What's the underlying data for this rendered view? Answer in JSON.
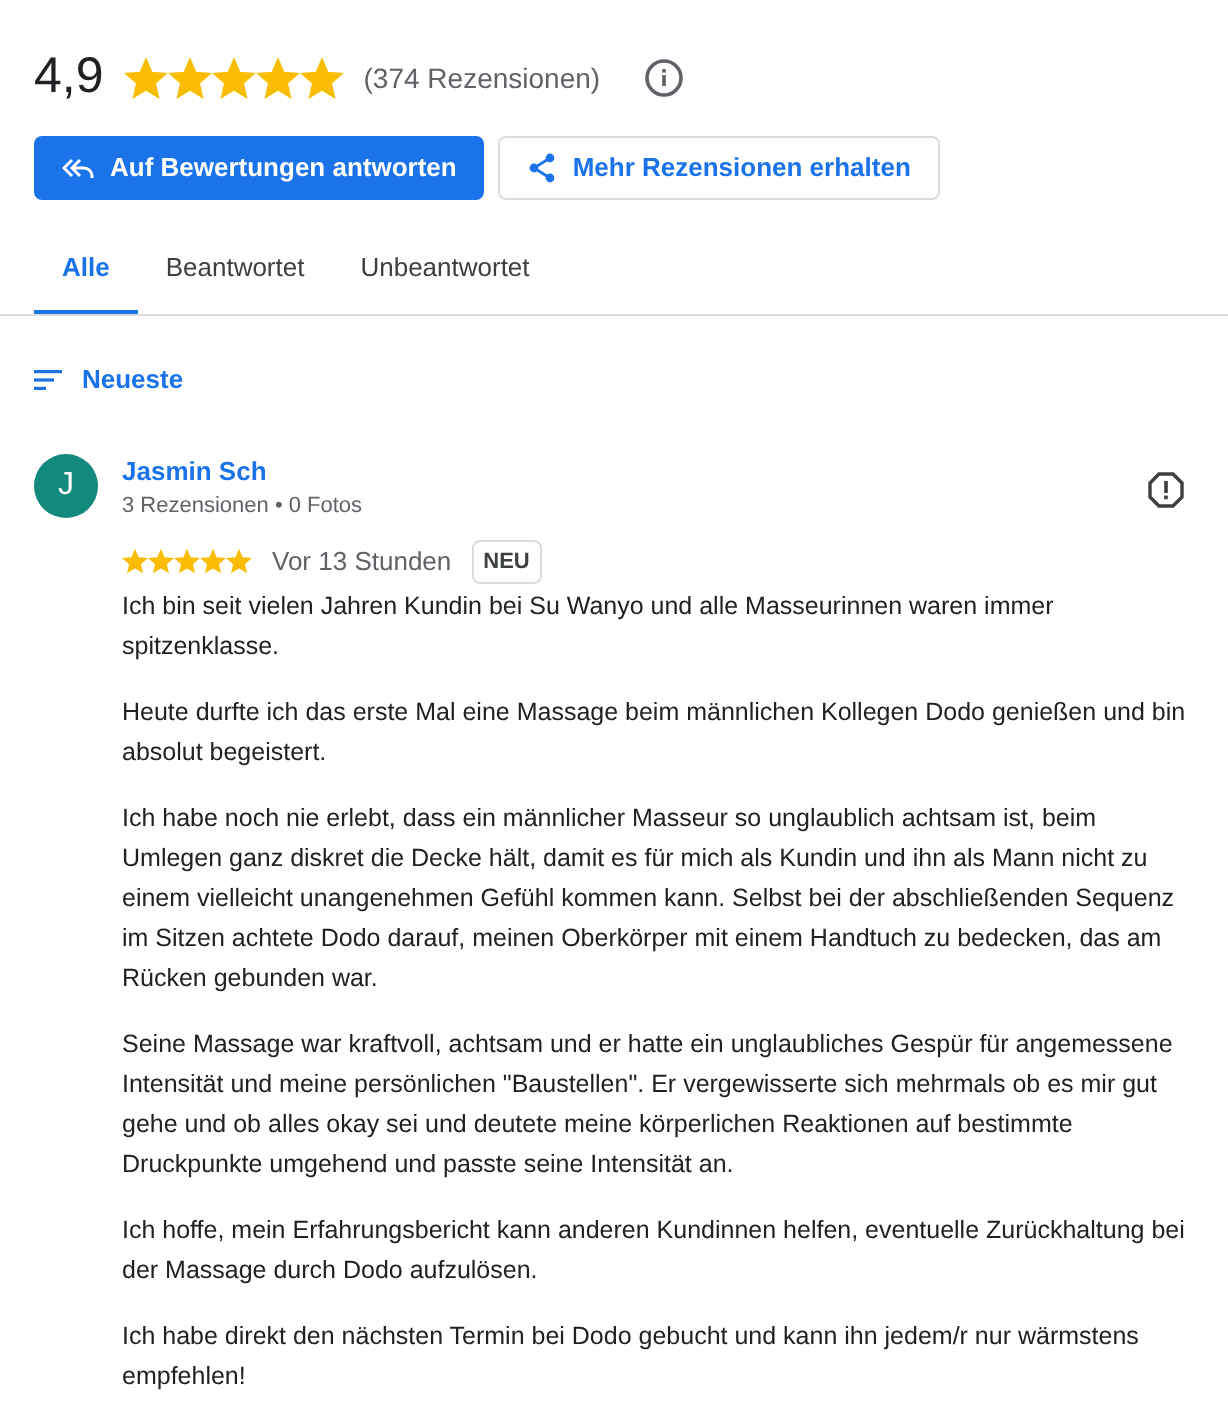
{
  "summary": {
    "rating": "4,9",
    "stars": 5,
    "count": "(374 Rezensionen)"
  },
  "actions": [
    {
      "label": "Auf Bewertungen antworten",
      "kind": "primary"
    },
    {
      "label": "Mehr Rezensionen erhalten",
      "kind": "secondary"
    }
  ],
  "tabs": [
    {
      "label": "Alle",
      "selected": true
    },
    {
      "label": "Beantwortet",
      "selected": false
    },
    {
      "label": "Unbeantwortet",
      "selected": false
    }
  ],
  "sort": {
    "label": "Neueste"
  },
  "reviews": [
    {
      "initial": "J",
      "color": "#12897b",
      "author": "Jasmin Sch",
      "meta": "3 Rezensionen • 0 Fotos",
      "stars": 5,
      "time": "Vor 13 Stunden",
      "badge": "NEU",
      "paragraphs": [
        "Ich bin seit vielen Jahren Kundin bei Su Wanyo und alle Masseurinnen waren immer spitzenklasse.",
        "Heute durfte ich das erste Mal eine Massage beim männlichen Kollegen Dodo genießen und bin absolut begeistert.",
        "Ich habe noch nie erlebt, dass ein männlicher Masseur so unglaublich achtsam ist, beim Umlegen ganz diskret die Decke hält, damit es für mich als Kundin und ihn als Mann nicht zu einem vielleicht unangenehmen Gefühl kommen kann. Selbst bei der abschließenden Sequenz im Sitzen achtete Dodo darauf, meinen Oberkörper mit einem Handtuch zu bedecken, das am Rücken gebunden war.",
        "Seine Massage war kraftvoll, achtsam und er hatte ein unglaubliches Gespür für angemessene Intensität und meine persönlichen \"Baustellen\". Er vergewisserte sich mehrmals ob es mir gut gehe und ob alles okay sei und deutete meine körperlichen Reaktionen auf bestimmte Druckpunkte umgehend und passte seine Intensität an.",
        "Ich hoffe, mein Erfahrungsbericht kann anderen Kundinnen helfen, eventuelle Zurückhaltung bei der Massage durch Dodo aufzulösen.",
        "Ich habe direkt den nächsten Termin bei Dodo gebucht und kann ihn jedem/r nur wärmstens empfehlen!"
      ]
    }
  ]
}
